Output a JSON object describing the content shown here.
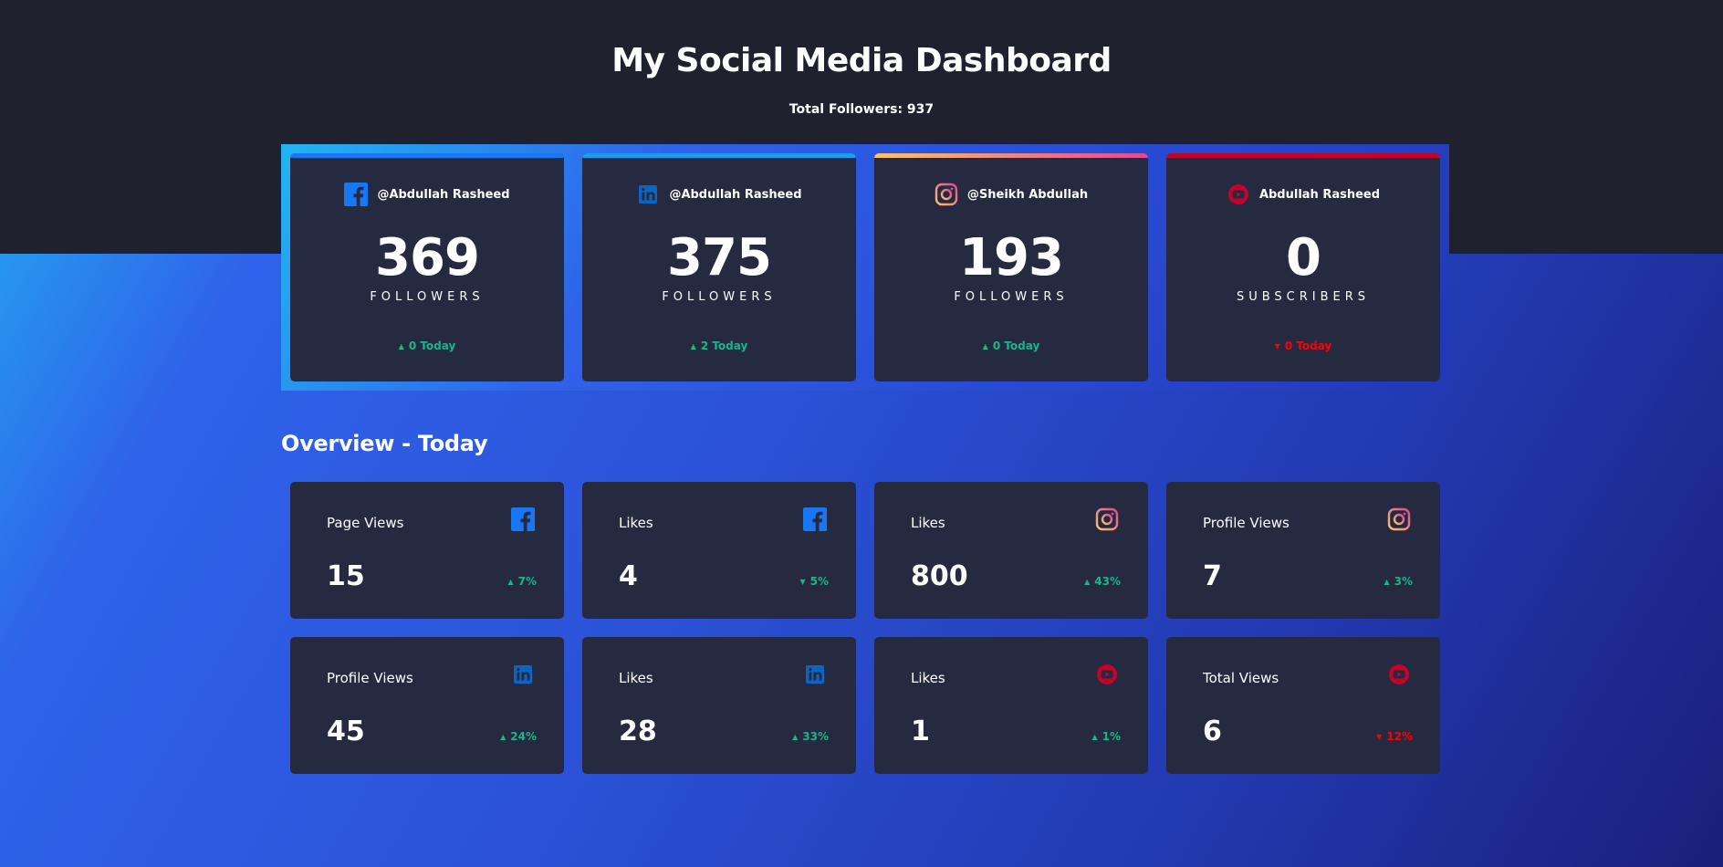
{
  "header": {
    "title": "My Social Media Dashboard",
    "total_followers": "Total Followers: 937"
  },
  "colors": {
    "facebook": "#1877f2",
    "linkedin": "#0a66c2",
    "instagram_gradient": [
      "#fdc468",
      "#df4996"
    ],
    "youtube": "#c4032b",
    "up": "#1db489",
    "down": "#ff0000",
    "card": "#252a41"
  },
  "followers": [
    {
      "icon": "facebook-icon",
      "handle": "@Abdullah Rasheed",
      "count": "369",
      "unit": "FOLLOWERS",
      "today": "0 Today",
      "trend": "up"
    },
    {
      "icon": "linkedin-icon",
      "handle": "@Abdullah Rasheed",
      "count": "375",
      "unit": "FOLLOWERS",
      "today": "2 Today",
      "trend": "up"
    },
    {
      "icon": "instagram-icon",
      "handle": "@Sheikh Abdullah",
      "count": "193",
      "unit": "FOLLOWERS",
      "today": "0 Today",
      "trend": "up"
    },
    {
      "icon": "youtube-icon",
      "handle": "Abdullah Rasheed",
      "count": "0",
      "unit": "SUBSCRIBERS",
      "today": "0 Today",
      "trend": "down"
    }
  ],
  "overview": {
    "title": "Overview - Today",
    "cards": [
      {
        "label": "Page Views",
        "icon": "facebook-icon",
        "value": "15",
        "pct": "7%",
        "trend": "up"
      },
      {
        "label": "Likes",
        "icon": "facebook-icon",
        "value": "4",
        "pct": "5%",
        "trend": "down"
      },
      {
        "label": "Likes",
        "icon": "instagram-icon",
        "value": "800",
        "pct": "43%",
        "trend": "up"
      },
      {
        "label": "Profile Views",
        "icon": "instagram-icon",
        "value": "7",
        "pct": "3%",
        "trend": "up"
      },
      {
        "label": "Profile Views",
        "icon": "linkedin-icon",
        "value": "45",
        "pct": "24%",
        "trend": "up"
      },
      {
        "label": "Likes",
        "icon": "linkedin-icon",
        "value": "28",
        "pct": "33%",
        "trend": "up"
      },
      {
        "label": "Likes",
        "icon": "youtube-icon",
        "value": "1",
        "pct": "1%",
        "trend": "up"
      },
      {
        "label": "Total Views",
        "icon": "youtube-icon",
        "value": "6",
        "pct": "12%",
        "trend": "down"
      }
    ]
  }
}
